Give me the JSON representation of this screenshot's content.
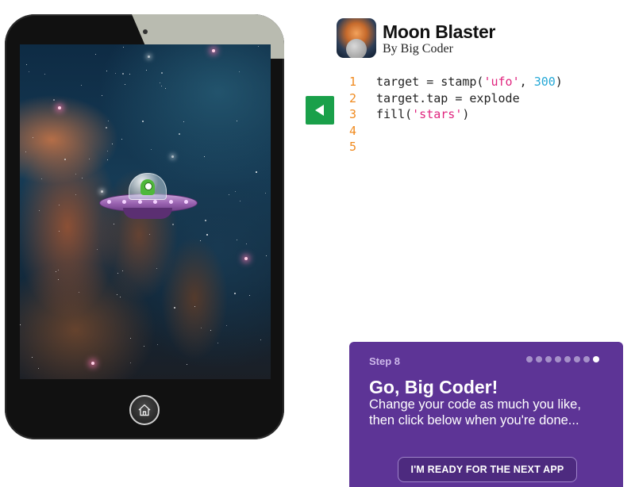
{
  "app": {
    "title": "Moon Blaster",
    "author": "By Big Coder",
    "icon": "moon-blaster-app-icon"
  },
  "editor": {
    "run_icon": "play-left-arrow-icon",
    "accent_color": "#1aa04a",
    "lines": [
      {
        "num": "1",
        "tokens": [
          {
            "t": "target = stamp(",
            "c": "tx"
          },
          {
            "t": "'ufo'",
            "c": "str"
          },
          {
            "t": ", ",
            "c": "tx"
          },
          {
            "t": "300",
            "c": "num"
          },
          {
            "t": ")",
            "c": "tx"
          }
        ]
      },
      {
        "num": "2",
        "tokens": [
          {
            "t": "target.tap = explode",
            "c": "tx"
          }
        ]
      },
      {
        "num": "3",
        "tokens": [
          {
            "t": "fill(",
            "c": "tx"
          },
          {
            "t": "'stars'",
            "c": "str"
          },
          {
            "t": ")",
            "c": "tx"
          }
        ]
      },
      {
        "num": "4",
        "tokens": []
      },
      {
        "num": "5",
        "tokens": []
      }
    ]
  },
  "device": {
    "home_icon": "home-icon",
    "sprite": "ufo-with-alien"
  },
  "step": {
    "label": "Step 8",
    "total_dots": 8,
    "active_dot": 8,
    "heading": "Go, Big Coder!",
    "text": "Change your code as much you like, then click below when you're done...",
    "button_label": "I'M READY FOR THE NEXT APP",
    "panel_color": "#5d3496"
  }
}
